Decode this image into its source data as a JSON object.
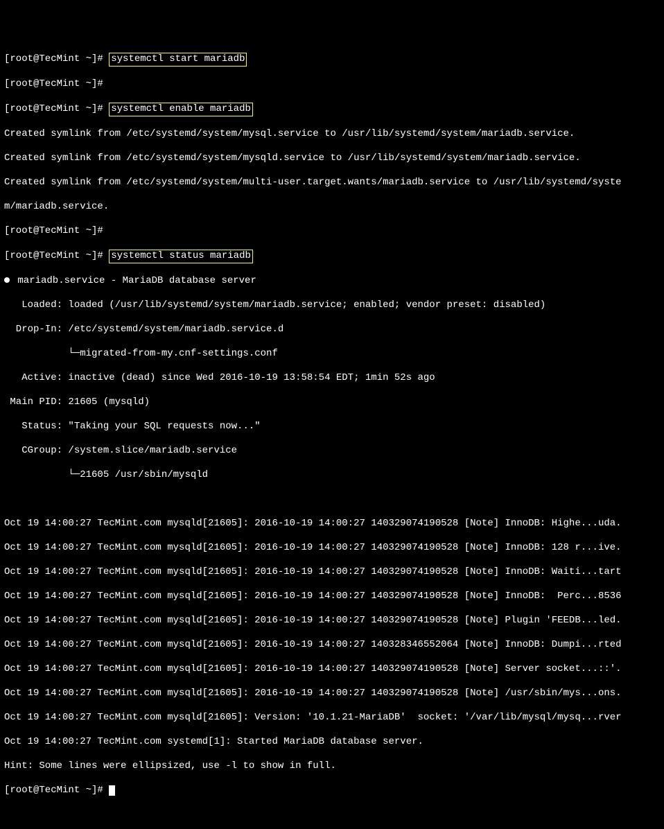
{
  "prompt": "[root@TecMint ~]# ",
  "cmd1": "systemctl start mariadb",
  "cmd2": "systemctl enable mariadb",
  "cmd3": "systemctl status mariadb",
  "symlink1": "Created symlink from /etc/systemd/system/mysql.service to /usr/lib/systemd/system/mariadb.service.",
  "symlink2": "Created symlink from /etc/systemd/system/mysqld.service to /usr/lib/systemd/system/mariadb.service.",
  "symlink3a": "Created symlink from /etc/systemd/system/multi-user.target.wants/mariadb.service to /usr/lib/systemd/syste",
  "symlink3b": "m/mariadb.service.",
  "svc_name": " mariadb.service - MariaDB database server",
  "loaded": "   Loaded: loaded (/usr/lib/systemd/system/mariadb.service; enabled; vendor preset: disabled)",
  "dropin1": "  Drop-In: /etc/systemd/system/mariadb.service.d",
  "dropin2": "           └─migrated-from-my.cnf-settings.conf",
  "active": "   Active: inactive (dead) since Wed 2016-10-19 13:58:54 EDT; 1min 52s ago",
  "mainpid": " Main PID: 21605 (mysqld)",
  "status": "   Status: \"Taking your SQL requests now...\"",
  "cgroup1": "   CGroup: /system.slice/mariadb.service",
  "cgroup2": "           └─21605 /usr/sbin/mysqld",
  "log1": "Oct 19 14:00:27 TecMint.com mysqld[21605]: 2016-10-19 14:00:27 140329074190528 [Note] InnoDB: Highe...uda.",
  "log2": "Oct 19 14:00:27 TecMint.com mysqld[21605]: 2016-10-19 14:00:27 140329074190528 [Note] InnoDB: 128 r...ive.",
  "log3": "Oct 19 14:00:27 TecMint.com mysqld[21605]: 2016-10-19 14:00:27 140329074190528 [Note] InnoDB: Waiti...tart",
  "log4": "Oct 19 14:00:27 TecMint.com mysqld[21605]: 2016-10-19 14:00:27 140329074190528 [Note] InnoDB:  Perc...8536",
  "log5": "Oct 19 14:00:27 TecMint.com mysqld[21605]: 2016-10-19 14:00:27 140329074190528 [Note] Plugin 'FEEDB...led.",
  "log6": "Oct 19 14:00:27 TecMint.com mysqld[21605]: 2016-10-19 14:00:27 140328346552064 [Note] InnoDB: Dumpi...rted",
  "log7": "Oct 19 14:00:27 TecMint.com mysqld[21605]: 2016-10-19 14:00:27 140329074190528 [Note] Server socket...::'.",
  "log8": "Oct 19 14:00:27 TecMint.com mysqld[21605]: 2016-10-19 14:00:27 140329074190528 [Note] /usr/sbin/mys...ons.",
  "log9": "Oct 19 14:00:27 TecMint.com mysqld[21605]: Version: '10.1.21-MariaDB'  socket: '/var/lib/mysql/mysq...rver",
  "log10": "Oct 19 14:00:27 TecMint.com systemd[1]: Started MariaDB database server.",
  "hint": "Hint: Some lines were ellipsized, use -l to show in full."
}
